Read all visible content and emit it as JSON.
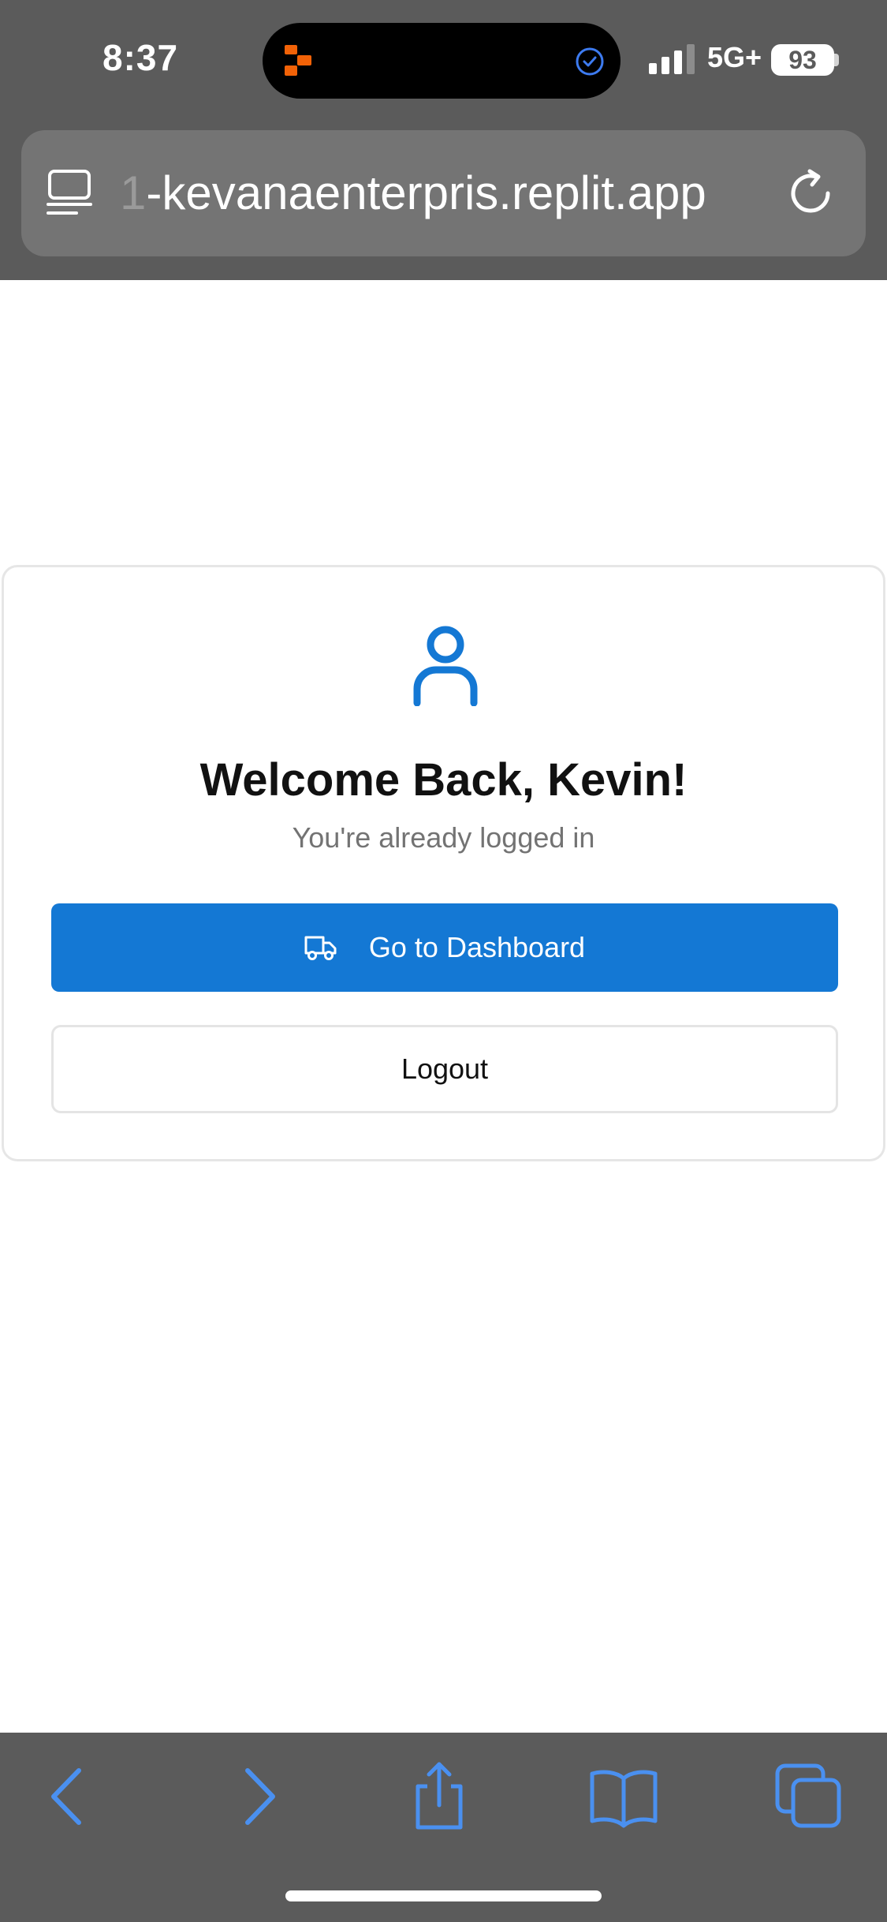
{
  "status_bar": {
    "time": "8:37",
    "network": "5G+",
    "battery": "93"
  },
  "browser": {
    "url_faded_prefix": "1",
    "url": "-kevanaenterpris.replit.app"
  },
  "login_card": {
    "title": "Welcome Back, Kevin!",
    "subtitle": "You're already logged in",
    "dashboard_button": "Go to Dashboard",
    "logout_button": "Logout"
  },
  "colors": {
    "primary": "#1478d4",
    "chrome": "#5b5b5b",
    "toolbar_icon": "#4a90f0"
  },
  "icons": [
    "reader-icon",
    "reload-icon",
    "user-icon",
    "truck-icon",
    "back-icon",
    "forward-icon",
    "share-icon",
    "bookmarks-icon",
    "tabs-icon"
  ]
}
